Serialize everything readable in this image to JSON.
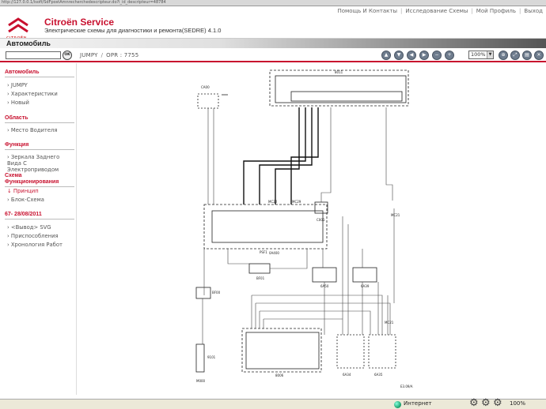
{
  "browser": {
    "url": "http://127.0.0.1/isoft/SdFpostAmnrecherchedescripteur.do?i_id_descripteur=48784"
  },
  "header": {
    "logo_text": "CITROËN",
    "title": "Citroën Service",
    "subtitle": "Электрические схемы для диагностики и ремонта(SEDRE) 4.1.0",
    "links": [
      "Помощь И Контакты",
      "Исследование Схемы",
      "Мой Профиль",
      "Выход"
    ]
  },
  "titleband": {
    "title": "Автомобиль"
  },
  "toolbar": {
    "search_value": "",
    "ok_label": "OK",
    "crumb_model": "JUMPY",
    "crumb_opr": "OPR : 7755",
    "zoom_value": "100%"
  },
  "sidebar": {
    "sections": [
      {
        "title": "Автомобиль",
        "items": [
          "JUMPY",
          "Характеристики",
          "Новый"
        ]
      },
      {
        "title": "Область",
        "items": [
          "Место Водителя"
        ]
      },
      {
        "title": "Функция",
        "items": [
          "Зеркала Заднего Вида С Электроприводом"
        ]
      },
      {
        "title": "Схема Функционирования",
        "items": [
          "Принцип",
          "Блок-Схема"
        ]
      },
      {
        "title": "67- 28/08/2011",
        "items": [
          "<Вывод> SVG",
          "Приспособления",
          "Хронология Работ"
        ]
      }
    ]
  },
  "diagram": {
    "labels": [
      "8011",
      "CA00",
      "PSF1",
      "MC22",
      "MC29",
      "C001",
      "MC21",
      "BF01",
      "BF00",
      "6A50",
      "6A39",
      "6A49",
      "6A34",
      "6A35",
      "MC21",
      "8006",
      "9101",
      "M000",
      "0A400",
      "E3.09/A"
    ]
  },
  "status": {
    "zone": "Интернет",
    "zoom": "100%"
  }
}
